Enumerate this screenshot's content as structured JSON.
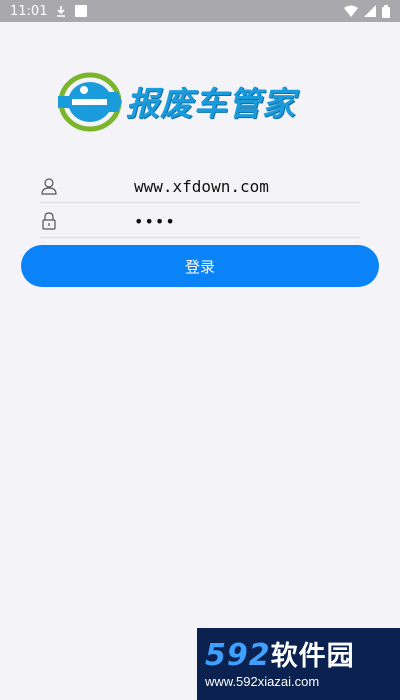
{
  "status_bar": {
    "time": "11:01"
  },
  "logo": {
    "text": "报废车管家"
  },
  "login": {
    "username_value": "www.xfdown.com",
    "password_masked": "••••",
    "button_label": "登录"
  },
  "watermark": {
    "brand": "592",
    "brand_suffix": "软件园",
    "url": "www.592xiazai.com"
  },
  "colors": {
    "accent": "#0a82f8",
    "logo_blue": "#1a9bdc",
    "logo_green": "#7bb52c"
  }
}
